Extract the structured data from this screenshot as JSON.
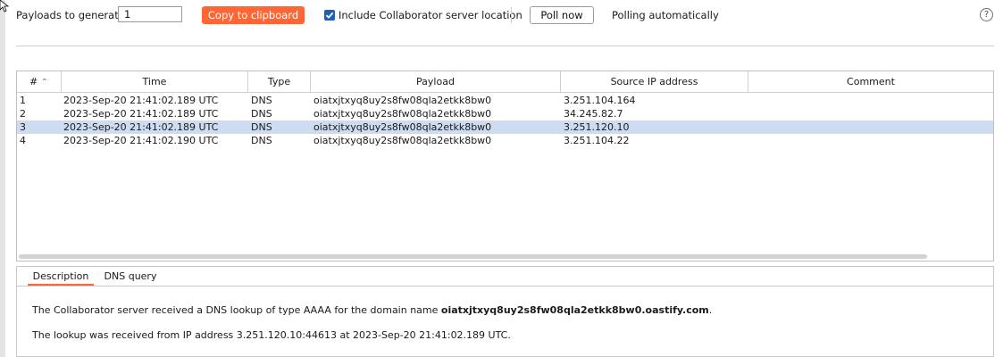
{
  "toolbar": {
    "payloads_label": "Payloads to generate:",
    "payloads_value": "1",
    "copy_button": "Copy to clipboard",
    "include_location_label": "Include Collaborator server location",
    "include_location_checked": true,
    "poll_button": "Poll now",
    "polling_status": "Polling automatically",
    "help_glyph": "?"
  },
  "table": {
    "columns": [
      "#",
      "Time",
      "Type",
      "Payload",
      "Source IP address",
      "Comment"
    ],
    "sort_indicator": "⌃",
    "rows": [
      {
        "num": "1",
        "time": "2023-Sep-20 21:41:02.189 UTC",
        "type": "DNS",
        "payload": "oiatxjtxyq8uy2s8fw08qla2etkk8bw0",
        "source_ip": "3.251.104.164",
        "comment": ""
      },
      {
        "num": "2",
        "time": "2023-Sep-20 21:41:02.189 UTC",
        "type": "DNS",
        "payload": "oiatxjtxyq8uy2s8fw08qla2etkk8bw0",
        "source_ip": "34.245.82.7",
        "comment": ""
      },
      {
        "num": "3",
        "time": "2023-Sep-20 21:41:02.189 UTC",
        "type": "DNS",
        "payload": "oiatxjtxyq8uy2s8fw08qla2etkk8bw0",
        "source_ip": "3.251.120.10",
        "comment": ""
      },
      {
        "num": "4",
        "time": "2023-Sep-20 21:41:02.190 UTC",
        "type": "DNS",
        "payload": "oiatxjtxyq8uy2s8fw08qla2etkk8bw0",
        "source_ip": "3.251.104.22",
        "comment": ""
      }
    ],
    "selected_row": "3"
  },
  "tabs": [
    {
      "label": "Description",
      "active": true
    },
    {
      "label": "DNS query",
      "active": false
    }
  ],
  "description": {
    "line1_prefix": "The Collaborator server received a DNS lookup of type AAAA for the domain name ",
    "line1_domain": "oiatxjtxyq8uy2s8fw08qla2etkk8bw0.oastify.com",
    "line1_suffix": ".",
    "line2": "The lookup was received from IP address 3.251.120.10:44613 at 2023-Sep-20 21:41:02.189 UTC."
  },
  "colors": {
    "accent": "#ff6633",
    "selected_row": "#cddcf0",
    "checkbox": "#1f5fb6"
  }
}
